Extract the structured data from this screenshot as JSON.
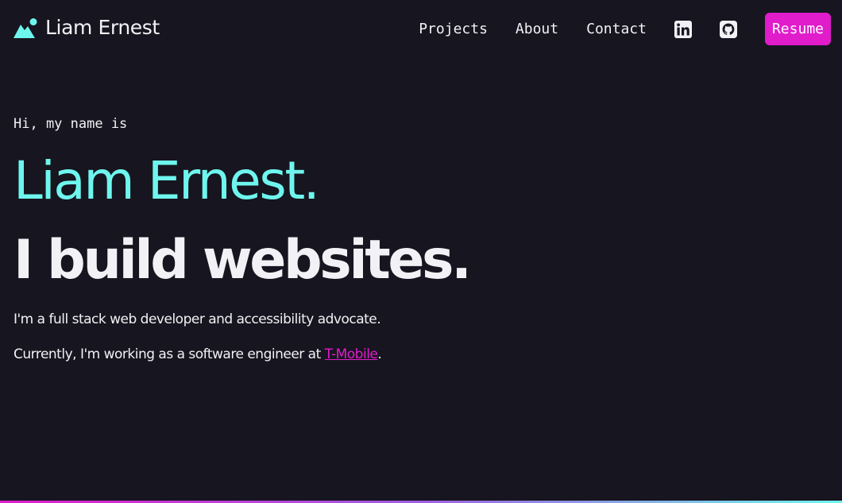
{
  "header": {
    "logo_text": "Liam Ernest",
    "logo_icon": "mountain-icon",
    "nav": {
      "projects": "Projects",
      "about": "About",
      "contact": "Contact",
      "linkedin_icon": "linkedin-icon",
      "github_icon": "github-icon",
      "resume": "Resume"
    }
  },
  "hero": {
    "intro": "Hi, my name is",
    "name": "Liam Ernest.",
    "tagline": "I build websites.",
    "bio": "I'm a full stack web developer and accessibility advocate.",
    "current_prefix": "Currently, I'm working as a software engineer at ",
    "employer": "T-Mobile",
    "current_suffix": "."
  },
  "colors": {
    "background": "#17151f",
    "accent_cyan": "#6ef6ee",
    "accent_magenta": "#e01ccb",
    "text": "#f2f1f5"
  }
}
